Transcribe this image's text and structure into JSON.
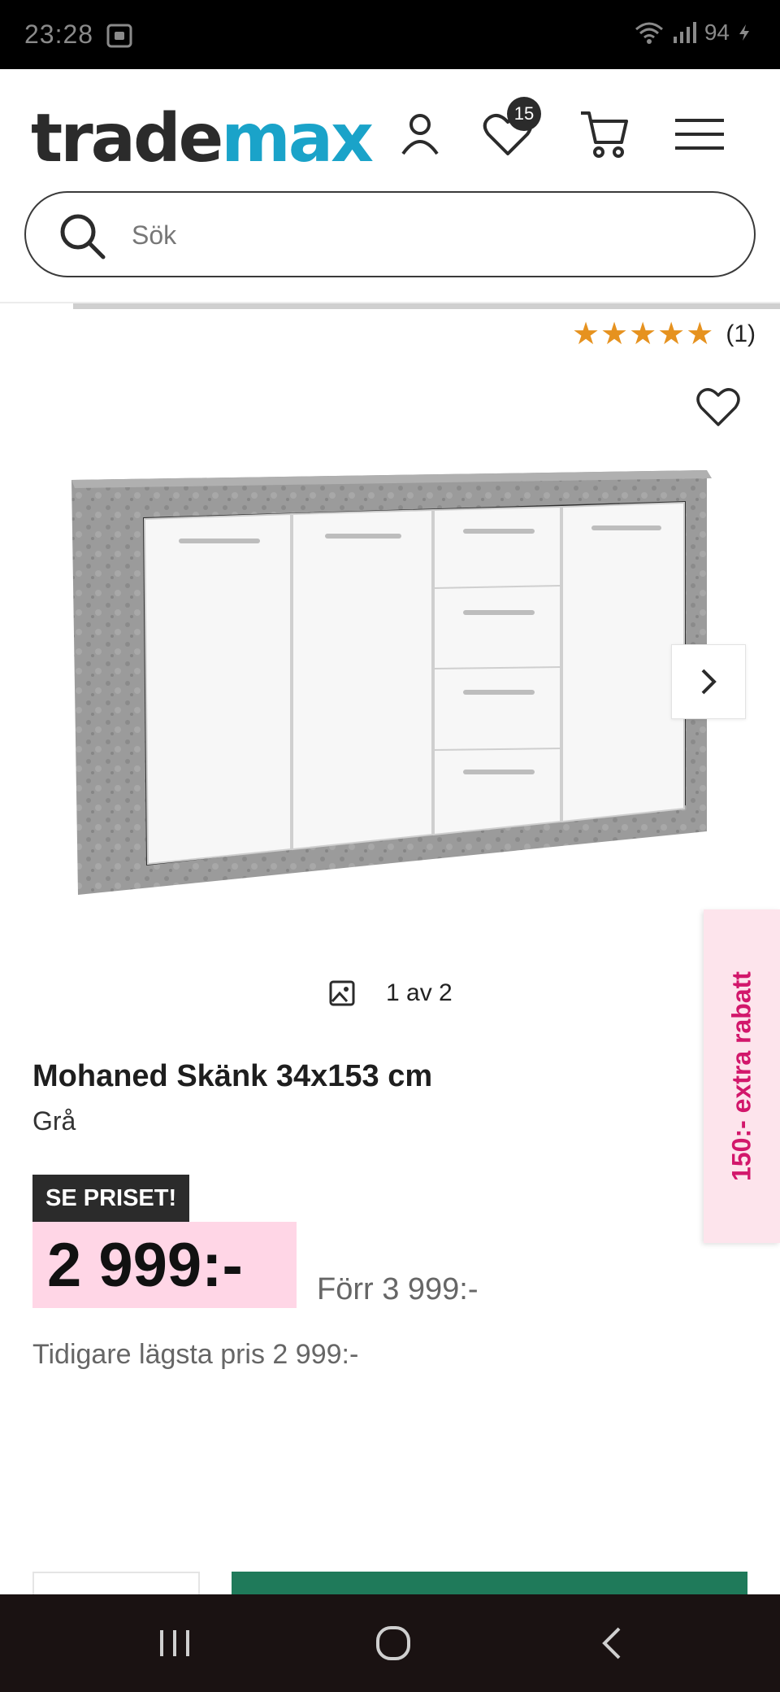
{
  "status": {
    "time": "23:28",
    "battery": "94"
  },
  "header": {
    "logo_part1": "trade",
    "logo_part2": "max",
    "wishlist_count": "15",
    "search_placeholder": "Sök"
  },
  "product": {
    "rating_stars": "★★★★★",
    "rating_count": "(1)",
    "image_counter": "1 av 2",
    "title": "Mohaned Skänk 34x153 cm",
    "variant": "Grå",
    "deal_label": "SE PRISET!",
    "price": "2 999:-",
    "old_price": "Förr 3 999:-",
    "lowest_price": "Tidigare lägsta pris 2 999:-"
  },
  "side_promo": "150:- extra rabatt",
  "colors": {
    "accent": "#1aa3c9",
    "promo_pink": "#d2176b",
    "price_bg": "#ffd6e6",
    "star": "#e6921f",
    "buy_green": "#1f7a5a"
  },
  "icons": [
    "screenshot-icon",
    "wifi-icon",
    "signal-icon",
    "battery-icon",
    "user-icon",
    "heart-icon",
    "cart-icon",
    "menu-icon",
    "search-icon",
    "chevron-right-icon",
    "image-icon",
    "recents-icon",
    "home-icon",
    "back-icon"
  ]
}
